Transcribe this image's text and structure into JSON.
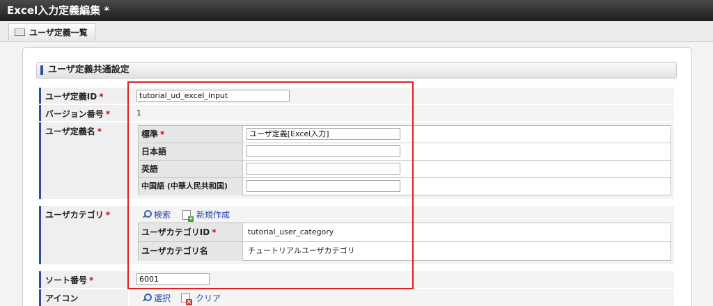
{
  "window": {
    "title": "Excel入力定義編集  *"
  },
  "tab": {
    "label": "ユーザ定義一覧"
  },
  "section": {
    "title": "ユーザ定義共通設定"
  },
  "required_mark": "*",
  "fields": {
    "user_def_id": {
      "label": "ユーザ定義ID",
      "value": "tutorial_ud_excel_input"
    },
    "version": {
      "label": "バージョン番号",
      "value": "1"
    },
    "user_def_name": {
      "label": "ユーザ定義名",
      "rows": [
        {
          "label": "標準",
          "required": true,
          "value": "ユーザ定義[Excel入力]"
        },
        {
          "label": "日本語",
          "value": ""
        },
        {
          "label": "英語",
          "value": ""
        },
        {
          "label": "中国語 (中華人民共和国)",
          "value": ""
        }
      ]
    },
    "user_category": {
      "label": "ユーザカテゴリ",
      "search_label": "検索",
      "new_label": "新規作成",
      "id_label": "ユーザカテゴリID",
      "id_value": "tutorial_user_category",
      "name_label": "ユーザカテゴリ名",
      "name_value": "チュートリアルユーザカテゴリ"
    },
    "sort_no": {
      "label": "ソート番号",
      "value": "6001"
    },
    "icon": {
      "label": "アイコン",
      "select_label": "選択",
      "clear_label": "クリア"
    }
  },
  "colors": {
    "accent": "#2d4e9a",
    "required": "#dd0000",
    "highlight": "#e02020",
    "link": "#2146a8"
  }
}
